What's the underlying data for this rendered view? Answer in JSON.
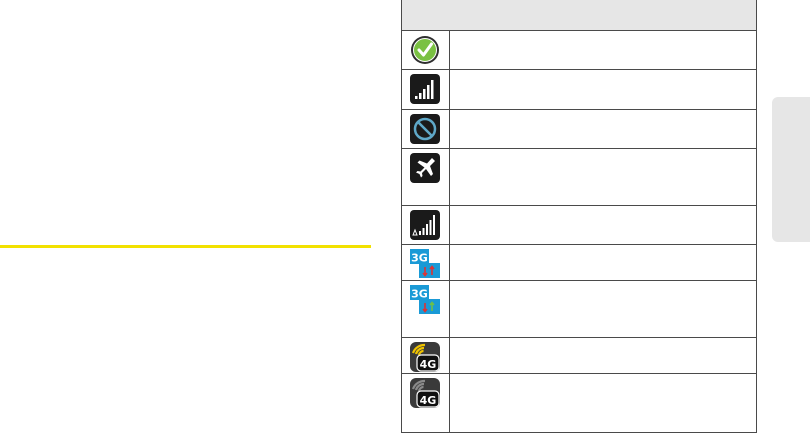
{
  "page": {
    "accent_color": "#f2e100",
    "side_tab_color": "#e6e6e6"
  },
  "icon_table": {
    "header_label": "",
    "rows": [
      {
        "icon": "check-circle-icon",
        "description": ""
      },
      {
        "icon": "signal-strength-icon",
        "description": ""
      },
      {
        "icon": "no-signal-icon",
        "description": ""
      },
      {
        "icon": "airplane-mode-icon",
        "description": ""
      },
      {
        "icon": "roaming-signal-icon",
        "description": ""
      },
      {
        "icon": "3g-connected-icon",
        "description": ""
      },
      {
        "icon": "3g-active-icon",
        "description": ""
      },
      {
        "icon": "4g-connected-icon",
        "description": ""
      },
      {
        "icon": "4g-inactive-icon",
        "description": ""
      }
    ]
  }
}
